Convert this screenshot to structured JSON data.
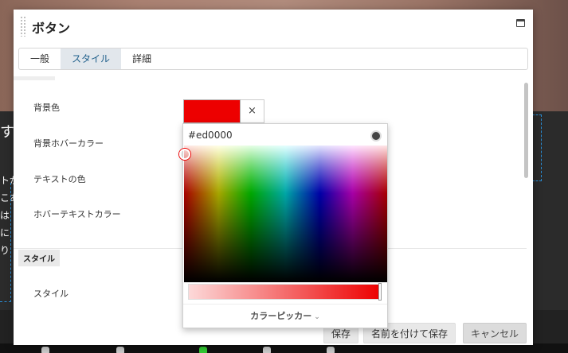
{
  "dialog": {
    "title": "ボタン",
    "tabs": [
      {
        "label": "一般",
        "active": false
      },
      {
        "label": "スタイル",
        "active": true
      },
      {
        "label": "詳細",
        "active": false
      }
    ]
  },
  "fields": {
    "bg_color": "背景色",
    "bg_hover_color": "背景ホバーカラー",
    "text_color": "テキストの色",
    "hover_text_color": "ホバーテキストカラー",
    "section_tag": "スタイル",
    "style_label": "スタイル"
  },
  "swatch": {
    "color": "#ed0000",
    "clear_symbol": "×"
  },
  "picker": {
    "hex_value": "#ed0000",
    "footer_label": "カラーピッカー",
    "footer_chevron": "⌄"
  },
  "buttons": {
    "save": "保存",
    "save_as": "名前を付けて保存",
    "cancel": "キャンセル"
  },
  "background": {
    "fragments": [
      "す。",
      "トが",
      "こあ",
      "は",
      "に",
      "り"
    ]
  }
}
